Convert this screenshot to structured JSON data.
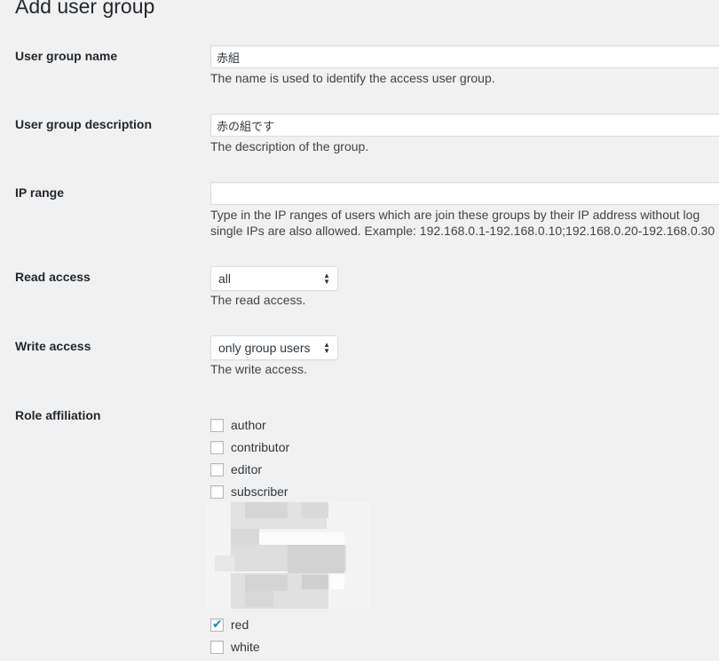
{
  "page": {
    "title": "Add user group"
  },
  "fields": {
    "name": {
      "label": "User group name",
      "value": "赤組",
      "description": "The name is used to identify the access user group."
    },
    "description": {
      "label": "User group description",
      "value": "赤の組です",
      "description": "The description of the group."
    },
    "ip_range": {
      "label": "IP range",
      "value": "",
      "description_line1": "Type in the IP ranges of users which are join these groups by their IP address without log",
      "description_line2": "single IPs are also allowed. Example: 192.168.0.1-192.168.0.10;192.168.0.20-192.168.0.30"
    },
    "read_access": {
      "label": "Read access",
      "selected": "all",
      "description": "The read access."
    },
    "write_access": {
      "label": "Write access",
      "selected": "only group users",
      "description": "The write access."
    },
    "role_affiliation": {
      "label": "Role affiliation",
      "roles": [
        {
          "label": "author",
          "checked": false
        },
        {
          "label": "contributor",
          "checked": false
        },
        {
          "label": "editor",
          "checked": false
        },
        {
          "label": "subscriber",
          "checked": false
        }
      ],
      "groups": [
        {
          "label": "red",
          "checked": true
        },
        {
          "label": "white",
          "checked": false
        }
      ]
    }
  },
  "colors": {
    "background": "#f1f1f1",
    "text": "#23282d",
    "checkmark": "#1e8cbe"
  }
}
